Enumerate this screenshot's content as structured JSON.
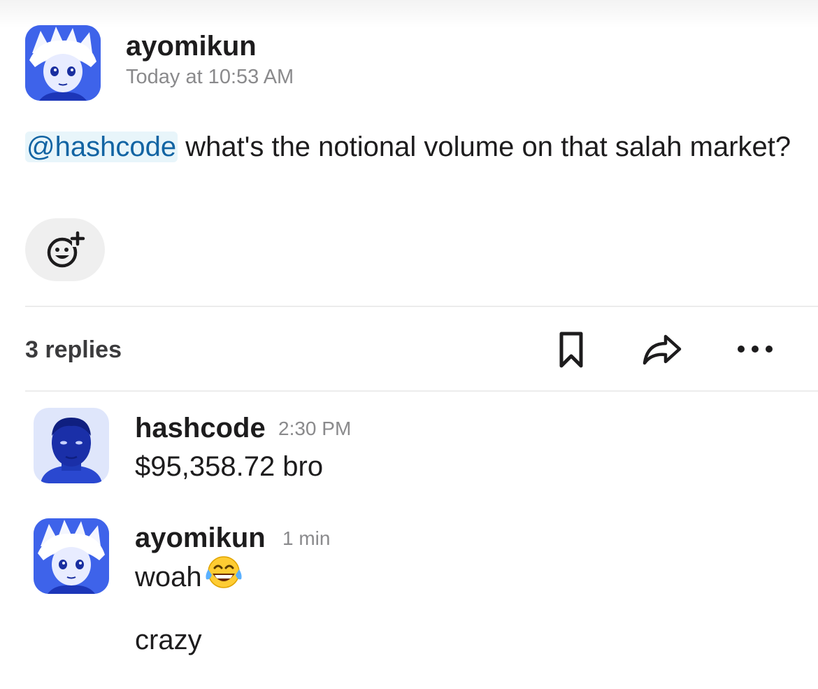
{
  "thread": {
    "author": "ayomikun",
    "timestamp": "Today at 10:53 AM",
    "mention": "@hashcode",
    "message": " what's the notional volume on that salah market?",
    "add_reaction_icon": "add-reaction-icon"
  },
  "thread_bar": {
    "replies_label": "3 replies",
    "save_icon": "bookmark-icon",
    "share_icon": "share-arrow-icon",
    "more_icon": "more-horizontal-icon"
  },
  "replies": [
    {
      "author": "hashcode",
      "time": "2:30 PM",
      "lines": [
        "$95,358.72 bro"
      ]
    },
    {
      "author": "ayomikun",
      "time": "1 min",
      "lines": [
        "woah",
        "crazy"
      ],
      "emoji": "face-with-tears-of-joy"
    }
  ],
  "colors": {
    "mention_text": "#1264a3",
    "mention_bg": "#e8f5fa",
    "avatar_tint": "#2f56e0",
    "meta_gray": "#8a8a8c"
  }
}
